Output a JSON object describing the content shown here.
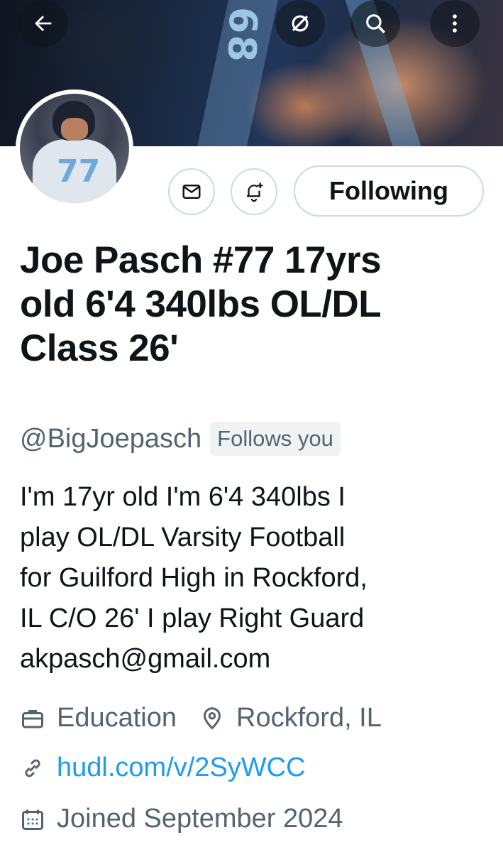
{
  "header": {
    "back_icon": "arrow-left-icon",
    "grok_icon": "grok-icon",
    "search_icon": "search-icon",
    "more_icon": "more-vertical-icon",
    "banner_jersey_number": "68"
  },
  "profile": {
    "avatar_jersey_number": "77",
    "display_name_lines": [
      "Joe Pasch #77 17yrs",
      "old 6'4 340lbs OL/DL",
      "Class 26'"
    ],
    "handle": "@BigJoepasch",
    "follows_you": "Follows you",
    "bio_lines": [
      "I'm 17yr old I'm 6'4 340lbs I",
      "play OL/DL Varsity Football",
      "for Guilford High in Rockford,",
      "IL C/O 26' I play Right Guard",
      "akpasch@gmail.com"
    ],
    "category": "Education",
    "location": "Rockford, IL",
    "website": "hudl.com/v/2SyWCC",
    "joined": "Joined September 2024"
  },
  "actions": {
    "message_icon": "envelope-icon",
    "notify_icon": "bell-plus-icon",
    "following_label": "Following"
  },
  "colors": {
    "text_primary": "#0f1419",
    "text_secondary": "#536471",
    "link": "#1d9bf0",
    "border": "#cfd9de"
  }
}
